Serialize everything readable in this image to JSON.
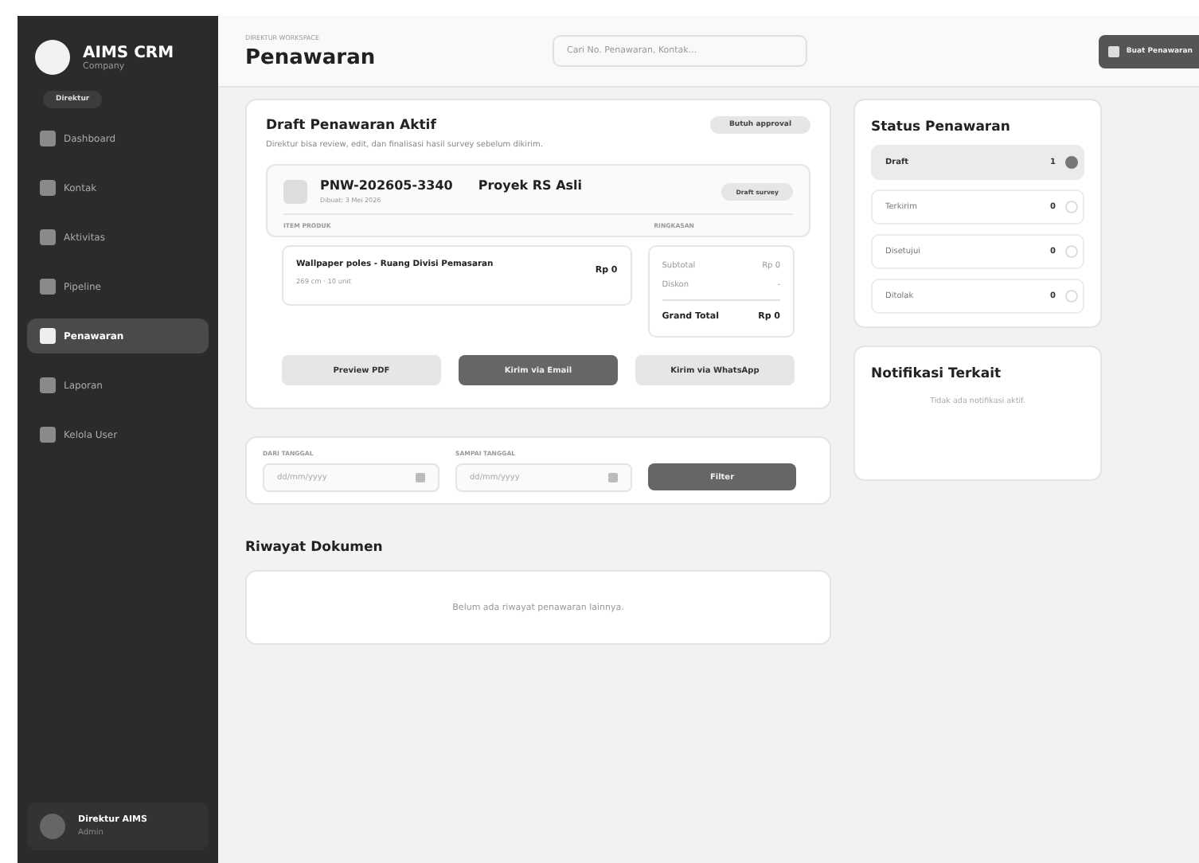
{
  "sidebar": {
    "brand": "AIMS CRM",
    "subtitle": "Company",
    "role": "Direktur",
    "items": [
      {
        "label": "Dashboard",
        "selected": false
      },
      {
        "label": "Kontak",
        "selected": false
      },
      {
        "label": "Aktivitas",
        "selected": false
      },
      {
        "label": "Pipeline",
        "selected": false
      },
      {
        "label": "Penawaran",
        "selected": true
      },
      {
        "label": "Laporan",
        "selected": false
      },
      {
        "label": "Kelola User",
        "selected": false
      }
    ],
    "user": {
      "name": "Direktur AIMS",
      "role": "Admin"
    }
  },
  "header": {
    "eyebrow": "DIREKTUR WORKSPACE",
    "title": "Penawaran",
    "search": {
      "placeholder": "Cari No. Penawaran, Kontak..."
    },
    "action": "Buat Penawaran"
  },
  "draft": {
    "title": "Draft Penawaran Aktif",
    "badge": "Butuh approval",
    "description": "Direktur bisa review, edit, dan finalisasi hasil survey sebelum dikirim.",
    "quote": {
      "number": "PNW-202605-3340",
      "project": "Proyek RS Asli",
      "created": "Dibuat: 3 Mei 2026",
      "status": "Draft survey"
    },
    "items_label": "ITEM PRODUK",
    "summary_label": "RINGKASAN",
    "items": [
      {
        "name": "Wallpaper poles - Ruang Divisi Pemasaran",
        "detail": "269 cm · 10 unit",
        "price": "Rp 0"
      }
    ],
    "summary": [
      {
        "label": "Subtotal",
        "value": "Rp 0"
      },
      {
        "label": "Diskon",
        "value": "-"
      }
    ],
    "total": {
      "label": "Grand Total",
      "value": "Rp 0"
    },
    "buttons": [
      {
        "label": "Preview PDF",
        "kind": "secondary"
      },
      {
        "label": "Kirim via Email",
        "kind": "primary"
      },
      {
        "label": "Kirim via WhatsApp",
        "kind": "secondary"
      }
    ]
  },
  "filter": {
    "from": {
      "label": "DARI TANGGAL",
      "placeholder": "dd/mm/yyyy"
    },
    "to": {
      "label": "SAMPAI TANGGAL",
      "placeholder": "dd/mm/yyyy"
    },
    "button": "Filter"
  },
  "history": {
    "title": "Riwayat Dokumen",
    "empty": "Belum ada riwayat penawaran lainnya."
  },
  "status": {
    "title": "Status Penawaran",
    "items": [
      {
        "label": "Draft",
        "count": "1",
        "selected": true
      },
      {
        "label": "Terkirim",
        "count": "0",
        "selected": false
      },
      {
        "label": "Disetujui",
        "count": "0",
        "selected": false
      },
      {
        "label": "Ditolak",
        "count": "0",
        "selected": false
      }
    ]
  },
  "notifications": {
    "title": "Notifikasi Terkait",
    "empty": "Tidak ada notifikasi aktif."
  }
}
